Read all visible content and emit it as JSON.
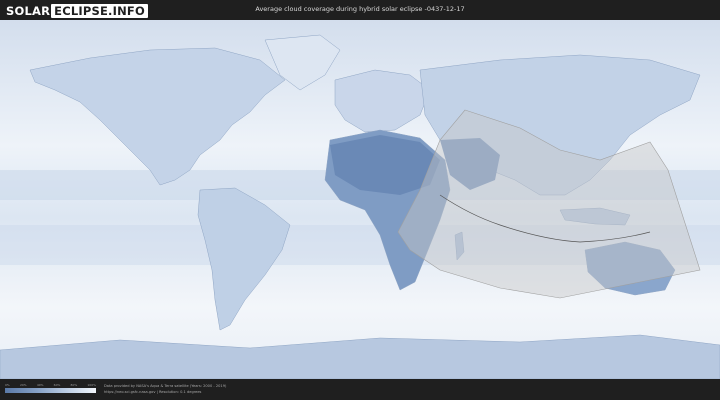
{
  "header": {
    "logo_part1": "SOLAR",
    "logo_part2": "ECLIPSE.INFO",
    "title": "Average cloud coverage during hybrid solar eclipse -0437-12-17"
  },
  "legend": {
    "ticks": [
      "0%",
      "20%",
      "40%",
      "60%",
      "80%",
      "100%"
    ],
    "colors": {
      "clear": "#5b7aa8",
      "cloudy": "#f2f6fb"
    }
  },
  "credits": {
    "line1": "Data provided by NASA's Aqua & Terra satellite (Years: 2000 - 2019)",
    "line2": "https://neo.sci.gsfc.nasa.gov  |  Resolution: 0.1 degrees"
  },
  "colors": {
    "background": "#1f1f1f",
    "ocean_cloud": "#e6edf6",
    "land_cloud": "#c6d4e8",
    "desert_clear": "#6f8db8",
    "eclipse_band": "#c8c8c8",
    "eclipse_centerline": "#555555"
  }
}
